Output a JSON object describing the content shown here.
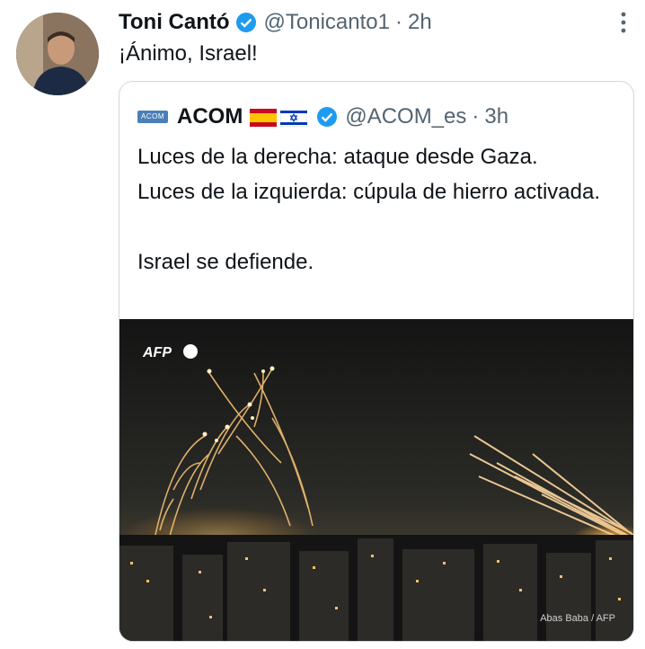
{
  "tweet": {
    "author_name": "Toni Cantó",
    "author_handle": "@Tonicanto1",
    "separator": "·",
    "time": "2h",
    "text": "¡Ánimo, Israel!",
    "icons": {
      "verified": "verified-badge-icon",
      "more": "more-options-icon"
    }
  },
  "quoted": {
    "logo_text": "ACOM",
    "author_name": "ACOM",
    "flags": [
      "spain-flag-icon",
      "israel-flag-icon"
    ],
    "author_handle": "@ACOM_es",
    "separator": "·",
    "time": "3h",
    "lines": [
      "Luces de la derecha: ataque desde Gaza.",
      "Luces de la izquierda: cúpula de hierro activada.",
      "",
      "Israel se defiende."
    ],
    "image": {
      "watermark": "AFP",
      "credit": "Abas Baba / AFP"
    }
  },
  "colors": {
    "verified": "#1d9bf0",
    "secondary_text": "#536471",
    "border": "#cfd9de"
  }
}
